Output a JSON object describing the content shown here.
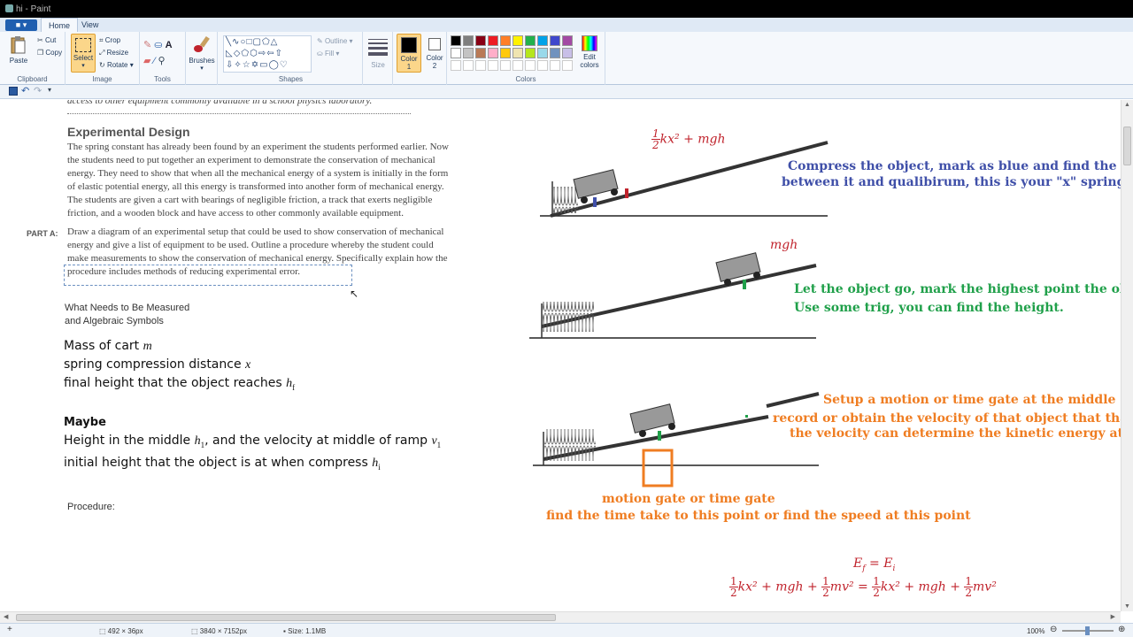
{
  "window": {
    "title": "hi - Paint"
  },
  "menu": {
    "file_label": "■ ▾",
    "tabs": [
      "Home",
      "View"
    ]
  },
  "ribbon": {
    "clipboard": {
      "label": "Clipboard",
      "paste": "Paste",
      "cut": "Cut",
      "copy": "Copy"
    },
    "image": {
      "label": "Image",
      "select": "Select",
      "crop": "Crop",
      "resize": "Resize",
      "rotate": "Rotate ▾"
    },
    "tools": {
      "label": "Tools"
    },
    "brushes": {
      "label": "Brushes"
    },
    "shapes": {
      "label": "Shapes",
      "outline": "Outline ▾",
      "fill": "Fill ▾"
    },
    "size": {
      "label": "Size"
    },
    "color1": {
      "label": "Color 1",
      "value": "#000000"
    },
    "color2": {
      "label": "Color 2",
      "value": "#ffffff"
    },
    "colors": {
      "label": "Colors",
      "palette": [
        "#000000",
        "#7f7f7f",
        "#880015",
        "#ed1c24",
        "#ff7f27",
        "#fff200",
        "#22b14c",
        "#00a2e8",
        "#3f48cc",
        "#a349a4",
        "#ffffff",
        "#c3c3c3",
        "#b97a57",
        "#ffaec9",
        "#ffc90e",
        "#efe4b0",
        "#b5e61d",
        "#99d9ea",
        "#7092be",
        "#c8bfe7"
      ]
    },
    "edit_colors": "Edit colors"
  },
  "document": {
    "top_line": "access to other equipment commonly available in a school physics laboratory.",
    "heading": "Experimental Design",
    "para1": [
      "The spring constant has already been found by an experiment the students performed earlier. Now",
      "the students need to put together an experiment to demonstrate the conservation of mechanical",
      "energy. They need to show that when all the mechanical energy of a system is initially in the form",
      "of elastic potential energy, all this energy is transformed into another form of mechanical energy.",
      "The students are given a cart with bearings of negligible friction, a track that exerts negligible",
      "friction, and a wooden block and have access to other commonly available equipment."
    ],
    "part_a": "PART A:",
    "para2": [
      "Draw a diagram of an experimental setup that could be used to show conservation of mechanical",
      "energy and give a list of equipment to be used. Outline a procedure whereby the student could",
      "make measurements to show the conservation of mechanical energy. Specifically explain how the",
      "procedure includes methods of reducing experimental error."
    ],
    "measure_head": [
      "What Needs to Be Measured",
      "and Algebraic Symbols"
    ],
    "m1": "Mass of cart",
    "m1s": "m",
    "m2": "spring compression distance",
    "m2s": "x",
    "m3": "final height that the object reaches",
    "m3s": "h",
    "m3sub": "f",
    "maybe": "Maybe",
    "m4a": "Height in the middle",
    "m4s1": "h",
    "m4sub1": "1",
    "m4b": ", and the velocity at middle of ramp",
    "m4s2": "v",
    "m4sub2": "1",
    "m5": "initial height that the object is at when compress",
    "m5s": "h",
    "m5sub": "i",
    "procedure": "Procedure:"
  },
  "notes": {
    "eq1": "kx² + mgh",
    "half": "1",
    "two": "2",
    "blue1": "Compress the object, mark as blue and find the diff",
    "blue2": "between it and qualibirum, this is your \"x\" spring di",
    "mgh": "mgh",
    "green1": "Let the object go, mark the highest point the objec",
    "green2": "Use some trig, you can find the height.",
    "orange1": "Setup a motion or time gate at the middle of t",
    "orange2": "record or obtain the velocity of that object that that o",
    "orange3": "the velocity can determine the kinetic energy at th",
    "gate1": "motion gate or time gate",
    "gate2": "find the time take to this point or find the speed at this point",
    "ef": "E",
    "ef_sub": "f",
    "eq_mid": " = ",
    "ei": "E",
    "ei_sub": "i",
    "final_eq": [
      "kx² + mgh + ",
      "mv² = ",
      "kx² + mgh + ",
      "mv²"
    ]
  },
  "status": {
    "cursor": "492 × 36px",
    "dimensions": "3840 × 7152px",
    "size": "Size: 1.1MB",
    "zoom": "100%"
  }
}
